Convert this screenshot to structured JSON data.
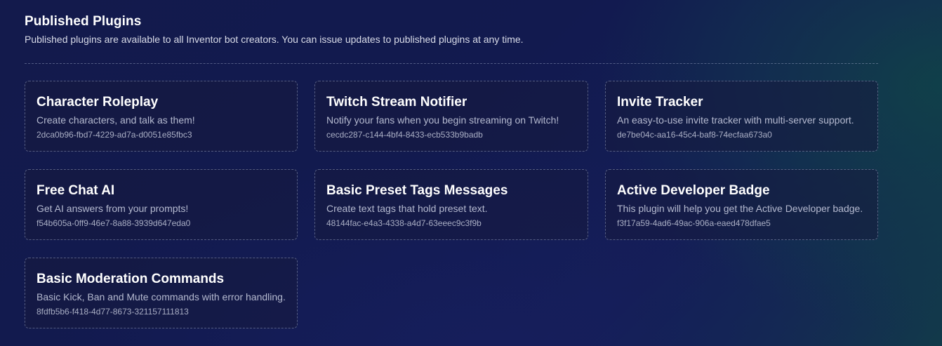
{
  "header": {
    "title": "Published Plugins",
    "description": "Published plugins are available to all Inventor bot creators. You can issue updates to published plugins at any time."
  },
  "plugins": [
    {
      "title": "Character Roleplay",
      "description": "Create characters, and talk as them!",
      "id": "2dca0b96-fbd7-4229-ad7a-d0051e85fbc3"
    },
    {
      "title": "Twitch Stream Notifier",
      "description": "Notify your fans when you begin streaming on Twitch!",
      "id": "cecdc287-c144-4bf4-8433-ecb533b9badb"
    },
    {
      "title": "Invite Tracker",
      "description": "An easy-to-use invite tracker with multi-server support.",
      "id": "de7be04c-aa16-45c4-baf8-74ecfaa673a0"
    },
    {
      "title": "Free Chat AI",
      "description": "Get AI answers from your prompts!",
      "id": "f54b605a-0ff9-46e7-8a88-3939d647eda0"
    },
    {
      "title": "Basic Preset Tags Messages",
      "description": "Create text tags that hold preset text.",
      "id": "48144fac-e4a3-4338-a4d7-63eeec9c3f9b"
    },
    {
      "title": "Active Developer Badge",
      "description": "This plugin will help you get the Active Developer badge.",
      "id": "f3f17a59-4ad6-49ac-906a-eaed478dfae5"
    },
    {
      "title": "Basic Moderation Commands",
      "description": "Basic Kick, Ban and Mute commands with error handling.",
      "id": "8fdfb5b6-f418-4d77-8673-321157111813"
    }
  ]
}
